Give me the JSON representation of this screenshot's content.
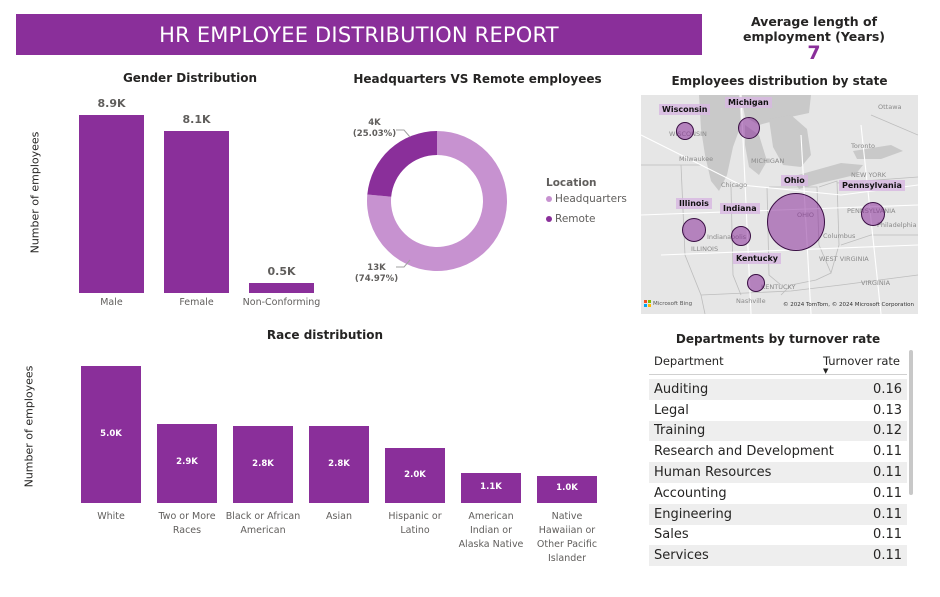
{
  "header": {
    "title": "HR EMPLOYEE DISTRIBUTION REPORT"
  },
  "kpi": {
    "label": "Average length of employment (Years)",
    "value": "7"
  },
  "gender": {
    "title": "Gender Distribution",
    "ylabel": "Number of employees",
    "bars": [
      {
        "category": "Male",
        "label": "8.9K"
      },
      {
        "category": "Female",
        "label": "8.1K"
      },
      {
        "category": "Non-Conforming",
        "label": "0.5K"
      }
    ]
  },
  "hq": {
    "title": "Headquarters VS Remote employees",
    "legend_title": "Location",
    "legend": [
      "Headquarters",
      "Remote"
    ],
    "remote_value": "4K",
    "remote_pct": "(25.03%)",
    "hq_value": "13K",
    "hq_pct": "(74.97%)"
  },
  "map": {
    "title": "Employees distribution by state",
    "states": [
      "Wisconsin",
      "Michigan",
      "Ohio",
      "Pennsylvania",
      "Illinois",
      "Indiana",
      "Kentucky"
    ],
    "place_labels": [
      "Ottawa",
      "Toronto",
      "MICHIGAN",
      "Milwaukee",
      "Chicago",
      "NEW YORK",
      "OHIO",
      "PENNSYLVANIA",
      "Columbus",
      "Philadelphia",
      "WEST VIRGINIA",
      "VIRGINIA",
      "KENTUCKY",
      "Nashville",
      "Indianapolis",
      "ILLINOIS",
      "WISCONSIN"
    ],
    "attribution": "© 2024 TomTom, © 2024 Microsoft Corporation",
    "brand": "Microsoft Bing"
  },
  "race": {
    "title": "Race distribution",
    "ylabel": "Number of employees",
    "bars": [
      {
        "category": "White",
        "label": "5.0K"
      },
      {
        "category": "Two or More Races",
        "label": "2.9K"
      },
      {
        "category": "Black or African American",
        "label": "2.8K"
      },
      {
        "category": "Asian",
        "label": "2.8K"
      },
      {
        "category": "Hispanic or Latino",
        "label": "2.0K"
      },
      {
        "category": "American Indian or Alaska Native",
        "label": "1.1K"
      },
      {
        "category": "Native Hawaiian or Other Pacific Islander",
        "label": "1.0K"
      }
    ]
  },
  "departments": {
    "title": "Departments by turnover rate",
    "col_dept": "Department",
    "col_rate": "Turnover rate",
    "rows": [
      {
        "dept": "Auditing",
        "rate": "0.16"
      },
      {
        "dept": "Legal",
        "rate": "0.13"
      },
      {
        "dept": "Training",
        "rate": "0.12"
      },
      {
        "dept": "Research and Development",
        "rate": "0.11"
      },
      {
        "dept": "Human Resources",
        "rate": "0.11"
      },
      {
        "dept": "Accounting",
        "rate": "0.11"
      },
      {
        "dept": "Engineering",
        "rate": "0.11"
      },
      {
        "dept": "Sales",
        "rate": "0.11"
      },
      {
        "dept": "Services",
        "rate": "0.11"
      }
    ]
  },
  "chart_data": [
    {
      "type": "bar",
      "title": "Gender Distribution",
      "ylabel": "Number of employees",
      "categories": [
        "Male",
        "Female",
        "Non-Conforming"
      ],
      "values": [
        8900,
        8100,
        500
      ],
      "color": "#8a2f9a"
    },
    {
      "type": "pie",
      "title": "Headquarters VS Remote employees",
      "categories": [
        "Headquarters",
        "Remote"
      ],
      "values": [
        13000,
        4000
      ],
      "percentages": [
        74.97,
        25.03
      ],
      "colors": [
        "#c792d0",
        "#8a2f9a"
      ],
      "donut": true
    },
    {
      "type": "bar",
      "title": "Race distribution",
      "ylabel": "Number of employees",
      "categories": [
        "White",
        "Two or More Races",
        "Black or African American",
        "Asian",
        "Hispanic or Latino",
        "American Indian or Alaska Native",
        "Native Hawaiian or Other Pacific Islander"
      ],
      "values": [
        5000,
        2900,
        2800,
        2800,
        2000,
        1100,
        1000
      ],
      "color": "#8a2f9a"
    }
  ]
}
